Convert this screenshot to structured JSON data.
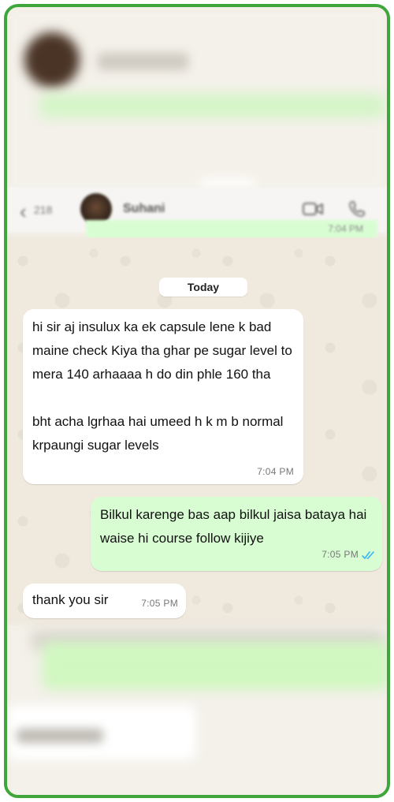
{
  "header": {
    "back_count": "218",
    "contact_name": "Suhani"
  },
  "prev_message": {
    "time": "7:04 PM"
  },
  "date_separator": "Today",
  "messages": [
    {
      "direction": "incoming",
      "paragraph1": "hi sir aj insulux ka ek capsule lene k bad maine check Kiya tha ghar pe sugar level to mera 140 arhaaaa h do din phle 160 tha",
      "paragraph2": "bht acha lgrhaa hai umeed h k m b normal krpaungi sugar levels",
      "time": "7:04 PM"
    },
    {
      "direction": "outgoing",
      "text": "Bilkul karenge bas aap bilkul jaisa bataya hai waise hi course follow kijiye",
      "time": "7:05 PM",
      "status": "read"
    },
    {
      "direction": "incoming",
      "text": "thank you sir",
      "time": "7:05 PM"
    }
  ],
  "colors": {
    "frame_border": "#3fa63c",
    "outgoing_bubble": "#d9fdd3",
    "incoming_bubble": "#ffffff",
    "read_ticks": "#34b7f1",
    "chat_background": "#efe9de"
  },
  "icons": [
    "chevron-left-icon",
    "video-call-icon",
    "phone-icon",
    "double-check-icon"
  ]
}
